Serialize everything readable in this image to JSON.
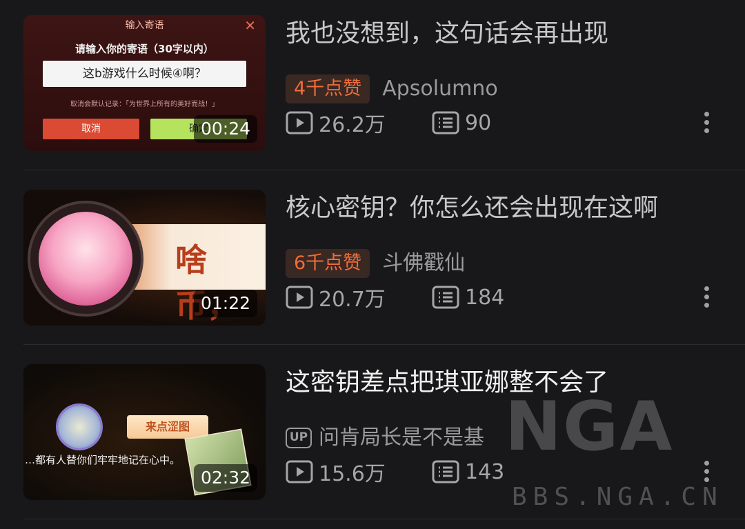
{
  "videos": [
    {
      "title": "我也没想到，这句话会再出现",
      "likes_badge": "4千点赞",
      "author": "Apsolumno",
      "views": "26.2万",
      "comments": "90",
      "duration": "00:24",
      "thumb": {
        "header": "输入寄语",
        "prompt": "请输入你的寄语（30字以内）",
        "input_value": "这b游戏什么时候④啊？",
        "note": "取消会默认记录：「为世界上所有的美好而战！」",
        "cancel": "取消",
        "confirm": "确定"
      }
    },
    {
      "title": "核心密钥？你怎么还会出现在这啊",
      "likes_badge": "6千点赞",
      "author": "斗佛戳仙",
      "views": "20.7万",
      "comments": "184",
      "duration": "01:22",
      "thumb": {
        "band_text": "啥币，"
      }
    },
    {
      "title": "这密钥差点把琪亚娜整不会了",
      "up_label": "UP",
      "author": "问肯局长是不是基",
      "views": "15.6万",
      "comments": "143",
      "duration": "02:32",
      "thumb": {
        "tag": "来点涩图",
        "subtitle": "…都有人替你们牢牢地记在心中。"
      }
    }
  ],
  "watermark": {
    "logo": "NGA",
    "site": "BBS.NGA.CN"
  },
  "colors": {
    "background": "#18181a",
    "badge_text": "#ef6d3c",
    "badge_bg": "#3a2822"
  },
  "icons": {
    "views": "play-icon",
    "comments": "danmaku-icon",
    "more": "more-icon"
  }
}
